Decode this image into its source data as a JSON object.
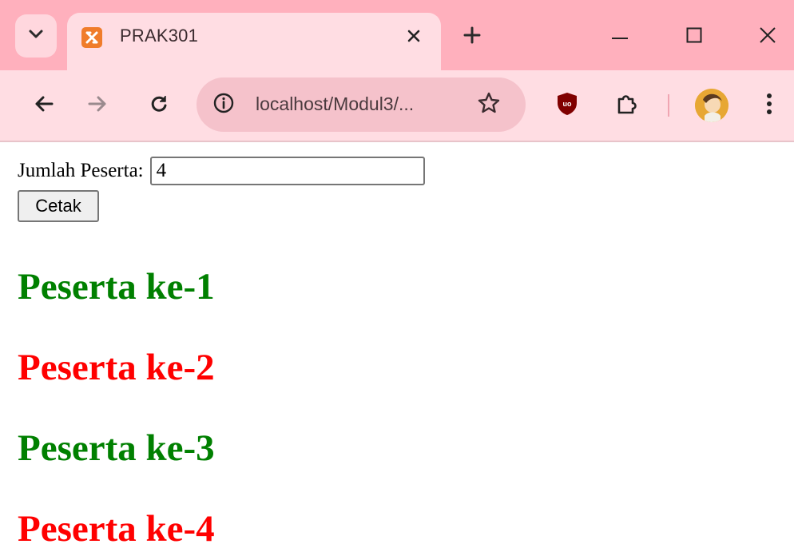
{
  "browser": {
    "tab": {
      "title": "PRAK301",
      "favicon": "xampp-icon"
    },
    "address_bar": {
      "url_display": "localhost/Modul3/..."
    },
    "icons": {
      "tab_search": "chevron-down-icon",
      "tab_close": "close-icon",
      "new_tab": "plus-icon",
      "minimize": "minimize-icon",
      "maximize": "maximize-icon",
      "window_close": "close-icon",
      "back": "arrow-left-icon",
      "forward": "arrow-right-icon",
      "reload": "reload-icon",
      "site_info": "info-icon",
      "bookmark": "star-icon",
      "ublock": "ublock-origin-icon",
      "extensions": "puzzle-icon",
      "profile": "avatar",
      "menu": "kebab-menu-icon"
    },
    "colors": {
      "tabstrip": "#ffb0bd",
      "toolbar": "#ffdde3"
    }
  },
  "page": {
    "form": {
      "label": "Jumlah Peserta:",
      "input_value": "4",
      "submit_label": "Cetak"
    },
    "participants": [
      {
        "text": "Peserta ke-1",
        "color": "#008000"
      },
      {
        "text": "Peserta ke-2",
        "color": "#ff0000"
      },
      {
        "text": "Peserta ke-3",
        "color": "#008000"
      },
      {
        "text": "Peserta ke-4",
        "color": "#ff0000"
      }
    ]
  }
}
